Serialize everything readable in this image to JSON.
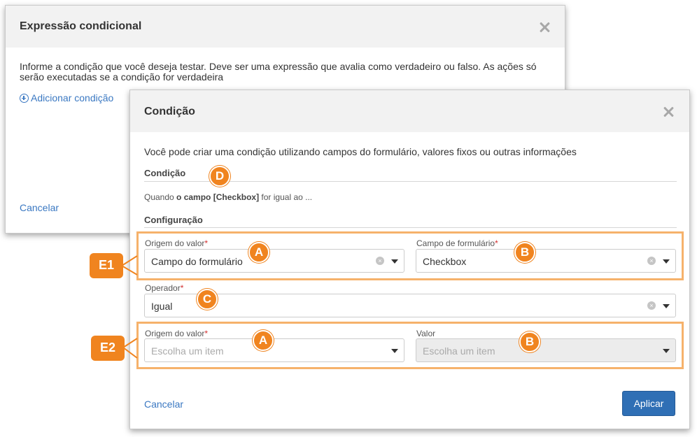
{
  "back_dialog": {
    "title": "Expressão condicional",
    "description": "Informe a condição que você deseja testar. Deve ser uma expressão que avalia como verdadeiro ou falso. As ações só serão executadas se a condição for verdadeira",
    "add_condition_label": "Adicionar condição",
    "cancel_label": "Cancelar"
  },
  "front_dialog": {
    "title": "Condição",
    "description": "Você pode criar uma condição utilizando campos do formulário, valores fixos ou outras informações",
    "condition_section": "Condição",
    "condition_summary": {
      "prefix": "Quando",
      "bold": "o campo [Checkbox]",
      "suffix": "for igual ao ..."
    },
    "config_section": "Configuração",
    "row1": {
      "origin_label": "Origem do valor",
      "origin_value": "Campo do formulário",
      "field_label": "Campo de formulário",
      "field_value": "Checkbox"
    },
    "operator": {
      "label": "Operador",
      "value": "Igual"
    },
    "row2": {
      "origin_label": "Origem do valor",
      "origin_placeholder": "Escolha um item",
      "value_label": "Valor",
      "value_placeholder": "Escolha um item"
    },
    "cancel_label": "Cancelar",
    "apply_label": "Aplicar"
  },
  "annotations": {
    "badges": [
      "A",
      "B",
      "C",
      "D",
      "A",
      "B"
    ],
    "tags": [
      "E1",
      "E2"
    ]
  },
  "colors": {
    "accent_orange": "#f0841f",
    "outline_orange": "#f6b26b",
    "link_blue": "#3a78c2",
    "primary_button": "#2f6fb5",
    "required_red": "#d32f2f"
  },
  "icons": {
    "close": "close-icon",
    "add": "plus-circle-icon",
    "clear": "clear-icon",
    "dropdown": "caret-down-icon"
  }
}
